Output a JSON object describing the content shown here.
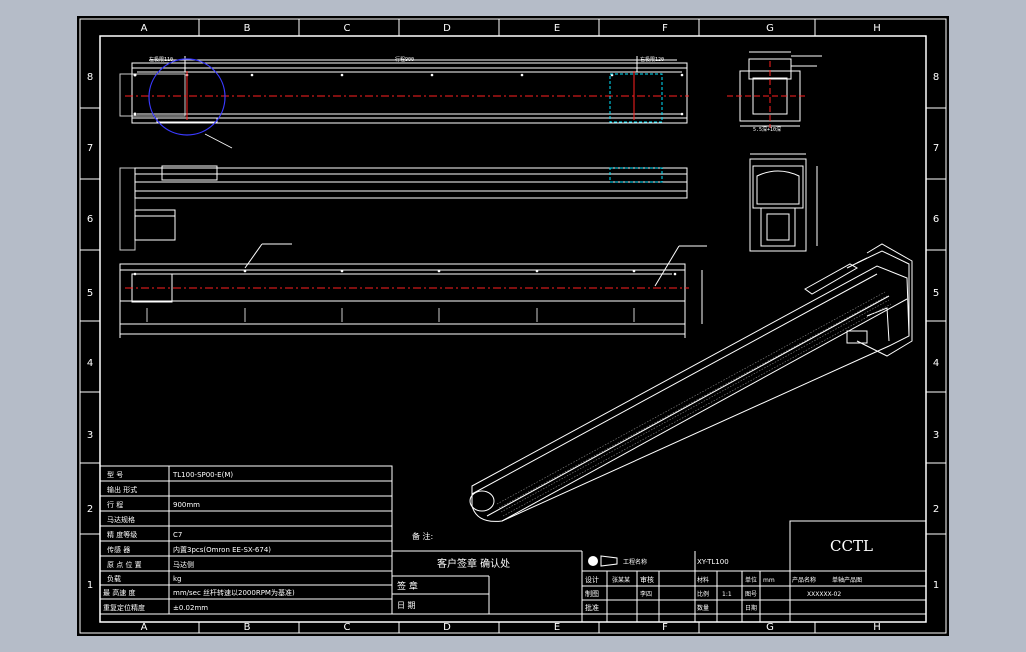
{
  "columns": [
    "A",
    "B",
    "C",
    "D",
    "E",
    "F",
    "G",
    "H"
  ],
  "rows": [
    "8",
    "7",
    "6",
    "5",
    "4",
    "3",
    "2",
    "1"
  ],
  "dims": {
    "left": "左极限110",
    "travel": "行程900",
    "right": "右极限120",
    "side": "5.5深+10深"
  },
  "spec_table": [
    {
      "label": "型 号",
      "value": "TL100-SP00-E(M)"
    },
    {
      "label": "输出 形式",
      "value": ""
    },
    {
      "label": "行 程",
      "value": "900mm"
    },
    {
      "label": "马达规格",
      "value": ""
    },
    {
      "label": "精 度等级",
      "value": "C7"
    },
    {
      "label": "传感 器",
      "value": "内置3pcs(Omron EE-SX-674)"
    },
    {
      "label": "原 点 位 置",
      "value": "马达侧"
    },
    {
      "label": "负载",
      "value": "kg"
    },
    {
      "label": "最 高速 度",
      "value": "mm/sec  丝杆转速以2000RPM为基准)"
    },
    {
      "label": "重复定位精度",
      "value": "±0.02mm"
    }
  ],
  "title_block": {
    "note": "备 注:",
    "confirm": "客户签章 确认处",
    "sign": "签 章",
    "date": "日 期",
    "project_label": "工程名称",
    "project": "XY-TL100",
    "company": "CCTL",
    "design": "设计",
    "draw": "制图",
    "check": "审核",
    "approve": "批准",
    "material": "材料",
    "qty": "数量",
    "scale": "比例",
    "scale_val": "1:1",
    "unit": "单位",
    "unit_val": "mm",
    "date2": "日期",
    "product": "产品名称",
    "product_val": "单轴产品图",
    "drawing_no": "图号",
    "drawing_no_val": "XXXXXX-02",
    "design_val": "张某某",
    "check_val": "李四"
  },
  "colors": {
    "background": "#b5bcc8",
    "sheet": "#000000",
    "line": "#ffffff",
    "centerline": "#ff2020",
    "circle": "#3a3aff",
    "hidden": "#00e5ff"
  },
  "icons": [
    "projection-symbol-icon"
  ]
}
